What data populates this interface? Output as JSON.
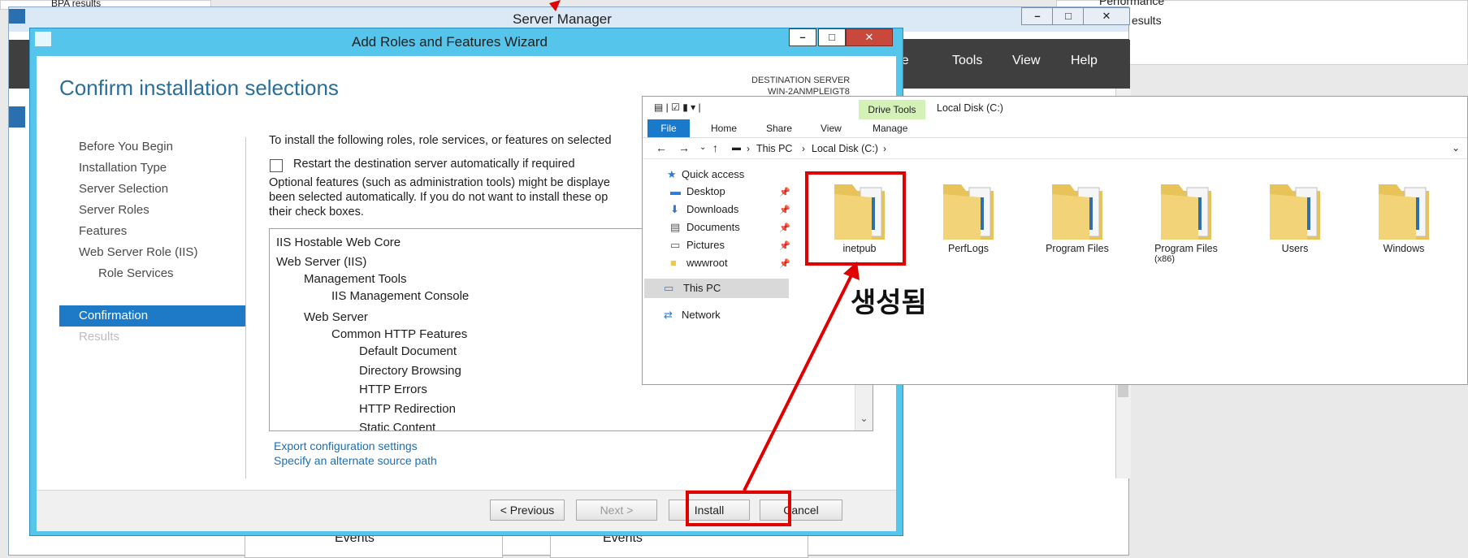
{
  "background": {
    "top_left_text": "BPA results",
    "top_right_text1": "Performance",
    "top_right_text2": "esults",
    "events_left": "Events",
    "events_right": "Events"
  },
  "server_manager": {
    "title": "Server Manager",
    "menu": [
      "age",
      "Tools",
      "View",
      "Help"
    ],
    "caption_buttons": [
      "–",
      "□",
      "✕"
    ]
  },
  "wizard": {
    "title": "Add Roles and Features Wizard",
    "caption_buttons": [
      "–",
      "□",
      "✕"
    ],
    "heading": "Confirm installation selections",
    "destination_label": "DESTINATION SERVER",
    "destination_value": "WIN-2ANMPLEIGT8",
    "nav": [
      "Before You Begin",
      "Installation Type",
      "Server Selection",
      "Server Roles",
      "Features",
      "Web Server Role (IIS)",
      "Role Services",
      "Confirmation",
      "Results"
    ],
    "intro": "To install the following roles, role services, or features on selected",
    "restart_label": "Restart the destination server automatically if required",
    "optional_text_1": "Optional features (such as administration tools) might be displaye",
    "optional_text_2": "been selected automatically. If you do not want to install these op",
    "optional_text_3": "their check boxes.",
    "list": [
      "IIS Hostable Web Core",
      "Web Server (IIS)",
      "Management Tools",
      "IIS Management Console",
      "Web Server",
      "Common HTTP Features",
      "Default Document",
      "Directory Browsing",
      "HTTP Errors",
      "HTTP Redirection",
      "Static Content"
    ],
    "export_link": "Export configuration settings",
    "alt_source_link": "Specify an alternate source path",
    "buttons": {
      "previous": "< Previous",
      "next": "Next >",
      "install": "Install",
      "cancel": "Cancel"
    }
  },
  "explorer": {
    "context_tab": "Drive Tools",
    "window_title": "Local Disk (C:)",
    "ribbon_tabs": [
      "File",
      "Home",
      "Share",
      "View",
      "Manage"
    ],
    "breadcrumb": [
      "This PC",
      "Local Disk (C:)"
    ],
    "nav": {
      "quick_access": "Quick access",
      "items": [
        "Desktop",
        "Downloads",
        "Documents",
        "Pictures",
        "wwwroot"
      ],
      "this_pc": "This PC",
      "network": "Network"
    },
    "folders": [
      "inetpub",
      "PerfLogs",
      "Program Files",
      "Program Files\n(x86)",
      "Users",
      "Windows"
    ]
  },
  "annotation": {
    "label": "생성됨",
    "color": "#e00000"
  }
}
